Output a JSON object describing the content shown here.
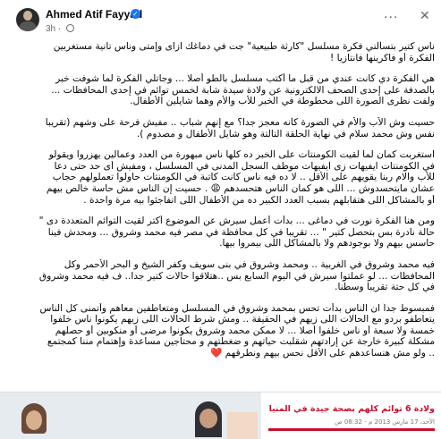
{
  "header": {
    "author": "Ahmed Atif Fayyad",
    "time": "3h",
    "verified_badge": "✓",
    "more_glyph": "···",
    "close_glyph": "✕"
  },
  "post": {
    "paragraphs": [
      [
        "ناس كتير بتسألني فكرة مسلسل \"كارثة طبيعية\" جت في دماغك ازاى وإمتى وناس تانية مستغربين",
        "الفكرة أو فاكرينها فانتازيا !"
      ],
      [
        "هي الفكرة دي كانت عندي من قبل ما أكتب مسلسل بالطو أصلا ... وجاتلي الفكرة لما شوفت خبر",
        "بالصدفة على إحدى الصحف الالكترونية  عن ولادة سيدة شابة لخمس توائم في إحدى المحافظات ...",
        "ولفت نظرى الصورة اللى محطوطة في الخبر للأب والأم وهما شايلين الأطفال."
      ],
      [
        "حسيت وش الأب والأم في الصورة كأنه معجز جدا؟ مع إنهم شباب .. مفيش فرحة على وشهم  (تقريبا",
        "نفس وش محمد سلام في نهاية الحلقة التالتة وهو شايل الأطفال و مصدوم )."
      ],
      [
        "استغربت كمان لما لقيت الكومنتات على الخبر ده كلها ناس مبهورة من العدد وعمالين يهزروا ويقولو",
        "في الكومنتات ايفيهات زى ايفيهات موظف السجل المدنى في المسلسل ، ومفيش أى حد حتى دعا",
        "للأب والام ربنا يقويهم على الأقل .. لا ده فيه ناس كانت كاتبة في الكومنتات حاولوا تعملولهم حجاب",
        "عشان مايتحسدوش ... اللى هو كمان الناس هتحسدهم 😩 . حسيت إن الناس مش حاسة خالص بيهم",
        "أو بالمشاكل اللى هتقابلهم بسبب العدد الكبير ده من الأطفال اللى اتفاجئوا بيه مرة واحدة ."
      ],
      [
        "ومن هنا الفكرة نورت في دماغى ... بدأت أعمل سيرش عن الموضوع أكتر لقيت التوائم المتعددة دى \"",
        "حالة نادرة بس بتحصل كتير \" ... تقريبا في كل محافظة في مصر فيه محمد وشروق ... ومحدش فينا",
        "حاسس بيهم ولا بوجودهم ولا بالمشاكل اللى بيمروا بيها."
      ],
      [
        "فيه محمد وشروق في الغربية .. ومحمد وشروق في بنى سويف وكفر الشيخ و البحر الأحمر وكل",
        "المحافظات ... لو عملتوا سيرش في اليوم السابع بس  ..هتلاقوا حالات كتير جدا.. ف فيه محمد وشروق",
        "في كل حتة تقريباً وسطنا."
      ],
      [
        "فمبسوط جداً ان الناس بدأت تحس بمحمد وشروق في المسلسل ومتعاطفين معاهم وأتمنى كل الناس",
        "يتعاطفو بردو مع الحالات اللى زيهم في الحقيقة .. ومش شرط الحالات اللى زيهم يكونوا ناس خلفوا",
        "خمسة ولا سبعة أو ناس خلفوا أصلا ... لا ممكن محمد وشروق يكونوا مرضى أو منكوبين أو حصلهم",
        "مشكلة كبيرة خارجة عن إرادتهم شقلبت حياتهم و ضغطتهم و محتاجين مساعدة وإهتمام مننا كمجتمع",
        ".. ولو مش هنساعدهم على الأقل نحس بيهم ونطرقهم ❤️"
      ]
    ]
  },
  "preview": {
    "headline": "ولادة 6 توائم كلهم بصحة جيدة في المنيا",
    "date": "الأحد، 17 مارس 2013 م - 08:32 ص"
  },
  "colors": {
    "verified": "#1877f2",
    "headline": "#c8102e",
    "text": "#050505",
    "muted": "#65676b"
  }
}
